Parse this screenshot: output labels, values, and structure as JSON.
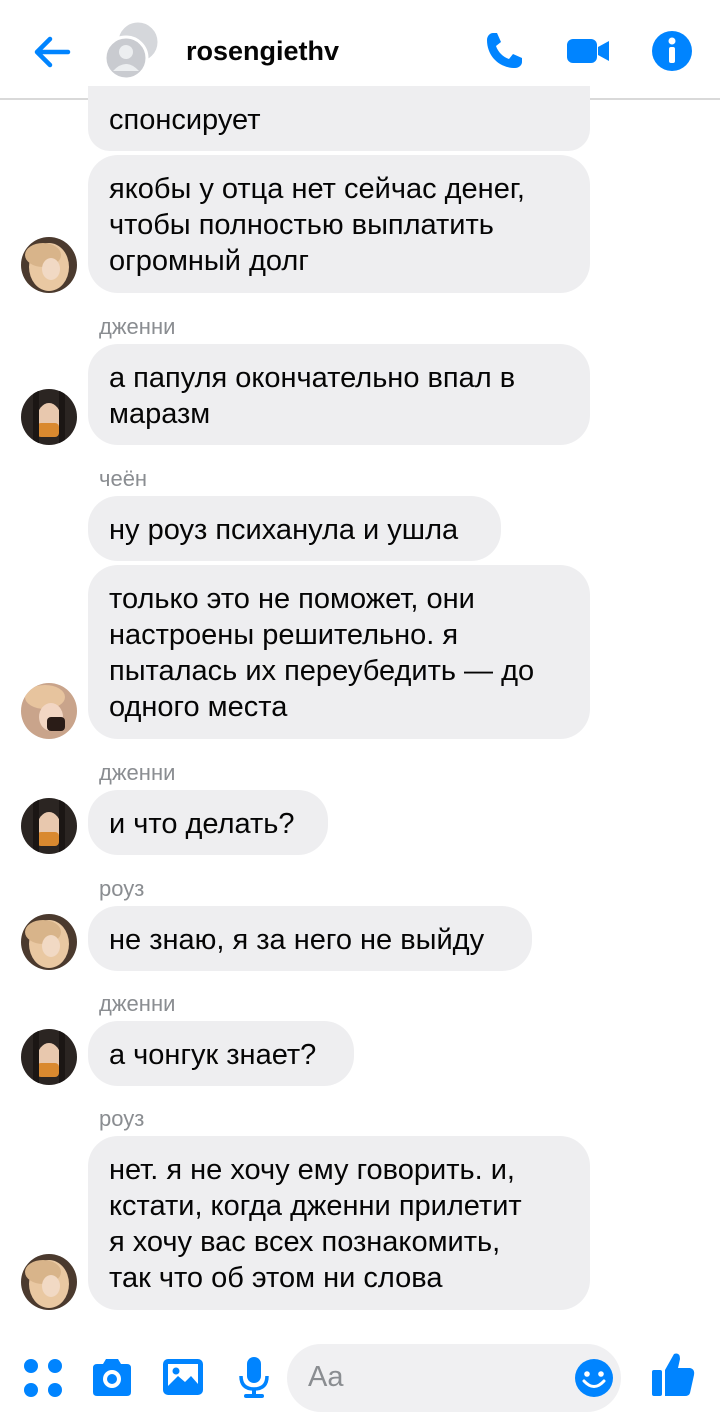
{
  "header": {
    "contact_name": "rosengiethv"
  },
  "messages": [
    {
      "text": "спонсирует"
    },
    {
      "text": "якобы у отца нет сейчас денег,\nчтобы полностью выплатить\nогромный долг"
    },
    {
      "sender": "дженни"
    },
    {
      "text": "а папуля окончательно впал в\nмаразм"
    },
    {
      "sender": "чеён"
    },
    {
      "text": "ну роуз психанула и ушла"
    },
    {
      "text": "только это не поможет, они\nнастроены решительно. я\nпыталась их переубедить — до\nодного места"
    },
    {
      "sender": "дженни"
    },
    {
      "text": "и что делать?"
    },
    {
      "sender": "роуз"
    },
    {
      "text": "не знаю, я за него не выйду"
    },
    {
      "sender": "дженни"
    },
    {
      "text": "а чонгук знает?"
    },
    {
      "sender": "роуз"
    },
    {
      "text": "нет. я не хочу ему говорить. и,\nкстати, когда дженни прилетит\nя хочу вас всех познакомить,\nтак что об этом ни слова"
    }
  ],
  "composer": {
    "placeholder": "Aa"
  },
  "colors": {
    "accent": "#0084ff",
    "bubble": "#eeeef0",
    "secondary_text": "#8a8d91"
  },
  "icons": [
    "back-arrow-icon",
    "group-avatar-icon",
    "phone-icon",
    "video-camera-icon",
    "info-icon",
    "menu-dots-icon",
    "camera-icon",
    "image-icon",
    "microphone-icon",
    "emoji-icon",
    "thumbs-up-icon"
  ]
}
